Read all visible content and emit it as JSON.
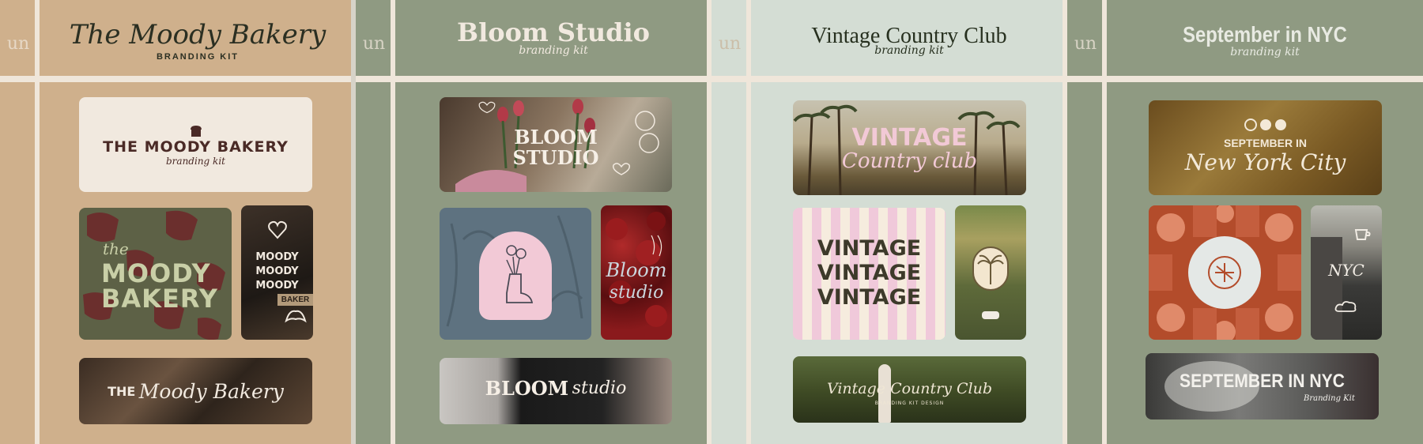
{
  "colors": {
    "tan": "#cfb08c",
    "sage": "#8f9a82",
    "mint": "#d4ddd4",
    "cream_line": "#efe6da",
    "dark_brown": "#4a2a26",
    "moody_green": "#5d6146",
    "bloom_blue": "#5e7280",
    "cherry": "#7a1a1a",
    "pink": "#f2c9d6",
    "rust": "#b34c2b",
    "olive_brown": "#7a5a2a"
  },
  "logo_mark": "un",
  "panels": [
    {
      "title": "The Moody Bakery",
      "subtitle": "BRANDING KIT",
      "cards": {
        "top": {
          "main": "THE MOODY BAKERY",
          "sub": "branding kit",
          "icon": "bread-icon"
        },
        "left": {
          "line1": "the",
          "line2": "MOODY",
          "line3": "BAKERY"
        },
        "right": {
          "lines": [
            "MOODY",
            "MOODY",
            "MOODY"
          ],
          "sign": "BAKER",
          "icon_top": "pretzel-heart-icon",
          "icon_bottom": "croissant-icon"
        },
        "bottom": {
          "prefix": "THE",
          "script": "Moody Bakery"
        }
      }
    },
    {
      "title": "Bloom Studio",
      "subtitle": "branding kit",
      "cards": {
        "top": {
          "line1": "BLOOM",
          "line2": "STUDIO"
        },
        "left": {
          "icon": "boot-bouquet-icon"
        },
        "right": {
          "line1": "Bloom",
          "line2": "studio",
          "icon": "cherries-icon"
        },
        "bottom": {
          "bold": "BLOOM",
          "script": "studio"
        }
      }
    },
    {
      "title": "Vintage Country Club",
      "subtitle": "branding kit",
      "cards": {
        "top": {
          "line1": "VINTAGE",
          "line2": "Country club"
        },
        "left": {
          "lines": [
            "VINTAGE",
            "VINTAGE",
            "VINTAGE"
          ]
        },
        "right": {
          "icon": "palm-tree-icon"
        },
        "bottom": {
          "script": "Vintage Country Club",
          "small": "BRANDING KIT DESIGN"
        }
      }
    },
    {
      "title": "September in NYC",
      "subtitle": "branding kit",
      "cards": {
        "top": {
          "line1": "SEPTEMBER IN",
          "line2": "New York City",
          "icon": "three-flowers-icon"
        },
        "left": {
          "icon": "flower-badge-icon"
        },
        "right": {
          "script": "NYC",
          "icon": "coffee-cup-icon"
        },
        "bottom": {
          "main": "SEPTEMBER IN NYC",
          "sub": "Branding Kit"
        }
      }
    }
  ]
}
